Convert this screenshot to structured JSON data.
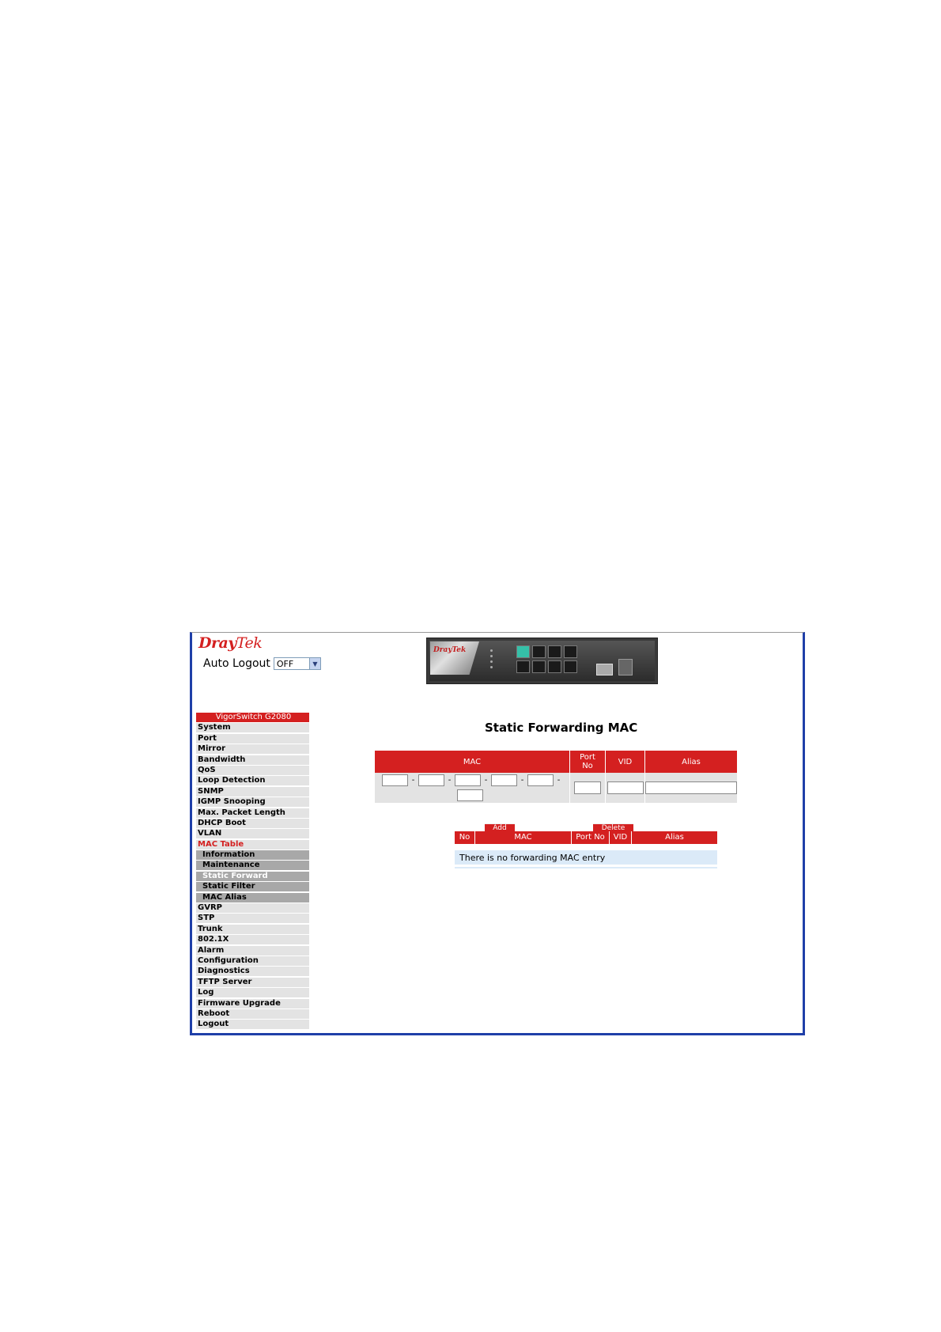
{
  "app": {
    "logo_main": "Dray",
    "logo_tek": "Tek",
    "auto_logout_label": "Auto Logout",
    "auto_logout_value": "OFF"
  },
  "device": {
    "brand": "DrayTek"
  },
  "menu": {
    "title": "VigorSwitch G2080",
    "items": [
      {
        "label": "System"
      },
      {
        "label": "Port"
      },
      {
        "label": "Mirror"
      },
      {
        "label": "Bandwidth"
      },
      {
        "label": "QoS"
      },
      {
        "label": "Loop Detection"
      },
      {
        "label": "SNMP"
      },
      {
        "label": "IGMP Snooping"
      },
      {
        "label": "Max. Packet Length"
      },
      {
        "label": "DHCP Boot"
      },
      {
        "label": "VLAN"
      },
      {
        "label": "MAC Table"
      },
      {
        "label": "Information"
      },
      {
        "label": "Maintenance"
      },
      {
        "label": "Static Forward"
      },
      {
        "label": "Static Filter"
      },
      {
        "label": "MAC Alias"
      },
      {
        "label": "GVRP"
      },
      {
        "label": "STP"
      },
      {
        "label": "Trunk"
      },
      {
        "label": "802.1X"
      },
      {
        "label": "Alarm"
      },
      {
        "label": "Configuration"
      },
      {
        "label": "Diagnostics"
      },
      {
        "label": "TFTP Server"
      },
      {
        "label": "Log"
      },
      {
        "label": "Firmware Upgrade"
      },
      {
        "label": "Reboot"
      },
      {
        "label": "Logout"
      }
    ]
  },
  "main": {
    "title": "Static Forwarding MAC",
    "entry": {
      "col_mac": "MAC",
      "col_port_line1": "Port",
      "col_port_line2": "No",
      "col_vid": "VID",
      "col_alias": "Alias"
    },
    "list": {
      "add_label": "Add",
      "delete_label": "Delete",
      "col_no": "No",
      "col_mac": "MAC",
      "col_port": "Port No",
      "col_vid": "VID",
      "col_alias": "Alias",
      "empty_message": "There is no forwarding MAC entry"
    }
  }
}
